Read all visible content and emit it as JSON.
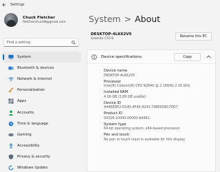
{
  "window": {
    "title": "Settings"
  },
  "profile": {
    "name": "Chuck Fletcher",
    "email": "fletcherchuck8@gmail.com"
  },
  "search": {
    "placeholder": "Find a setting",
    "icon": "search-icon"
  },
  "nav": {
    "items": [
      {
        "label": "System",
        "icon": "monitor-icon",
        "color": "#1f6fc4",
        "selected": true
      },
      {
        "label": "Bluetooth & devices",
        "icon": "bluetooth-devices-icon",
        "color": "#2b7cd3"
      },
      {
        "label": "Network & internet",
        "icon": "wifi-icon",
        "color": "#2b7cd3"
      },
      {
        "label": "Personalization",
        "icon": "paintbrush-icon",
        "color": "#d9742b"
      },
      {
        "label": "Apps",
        "icon": "apps-icon",
        "color": "#5b6b7c"
      },
      {
        "label": "Accounts",
        "icon": "person-icon",
        "color": "#1fa35b"
      },
      {
        "label": "Time & language",
        "icon": "clock-globe-icon",
        "color": "#2b7cd3"
      },
      {
        "label": "Gaming",
        "icon": "controller-icon",
        "color": "#5b6b7c"
      },
      {
        "label": "Accessibility",
        "icon": "accessibility-icon",
        "color": "#2b7cd3"
      },
      {
        "label": "Privacy & security",
        "icon": "shield-icon",
        "color": "#5b6b7c"
      },
      {
        "label": "Windows Update",
        "icon": "update-icon",
        "color": "#2b7cd3"
      }
    ]
  },
  "breadcrumb": {
    "parent": "System",
    "separator": ">",
    "current": "About"
  },
  "device": {
    "name": "DESKTOP-4LK62V5",
    "model": "Satellite C55-B",
    "rename_label": "Rename this PC"
  },
  "specs": {
    "title": "Device specifications",
    "copy_label": "Copy",
    "items": [
      {
        "label": "Device name",
        "value": "DESKTOP-4LK62V5"
      },
      {
        "label": "Processor",
        "value": "Intel(R) Celeron(R) CPU  N2840  @ 2.16GHz   2.16 GHz"
      },
      {
        "label": "Installed RAM",
        "value": "4.00 GB (3.89 GB usable)"
      },
      {
        "label": "Device ID",
        "value": "A44E8DE2-D145-4F45-8243-798E6DB17DD7"
      },
      {
        "label": "Product ID",
        "value": "00326-10000-00000-AA961"
      },
      {
        "label": "System type",
        "value": "64-bit operating system, x64-based processor"
      },
      {
        "label": "Pen and touch",
        "value": "No pen or touch input is available for this display"
      }
    ]
  },
  "colors": {
    "accent": "#0067c0",
    "background": "#f3f3f3",
    "card": "#fbfbfb"
  }
}
